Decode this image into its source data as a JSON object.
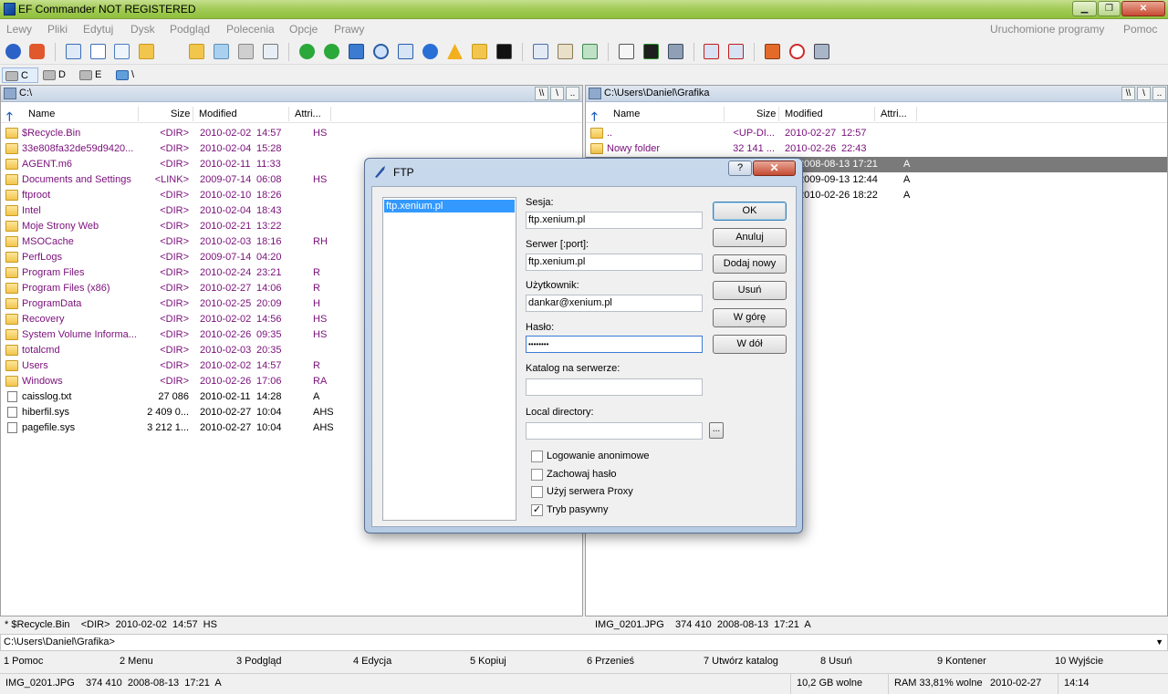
{
  "window": {
    "title": "EF Commander NOT REGISTERED",
    "min": "▁",
    "max": "❐",
    "close": "✕"
  },
  "menu": {
    "left": [
      "Lewy",
      "Pliki",
      "Edytuj",
      "Dysk",
      "Podgląd",
      "Polecenia",
      "Opcje",
      "Prawy"
    ],
    "right": [
      "Uruchomione programy",
      "Pomoc"
    ]
  },
  "drives": [
    {
      "letter": "C",
      "icon": "hard-drive-icon"
    },
    {
      "letter": "D",
      "icon": "optical-drive-icon"
    },
    {
      "letter": "E",
      "icon": "removable-drive-icon"
    },
    {
      "letter": "\\",
      "icon": "network-icon"
    }
  ],
  "left_panel": {
    "path": "C:\\",
    "headers": {
      "name": "Name",
      "size": "Size",
      "modified": "Modified",
      "attr": "Attri..."
    },
    "nav_buttons": [
      "\\\\",
      "\\",
      ".."
    ],
    "rows": [
      {
        "name": "$Recycle.Bin",
        "size": "<DIR>",
        "date": "2010-02-02",
        "time": "14:57",
        "attr": "HS",
        "type": "folder"
      },
      {
        "name": "33e808fa32de59d9420...",
        "size": "<DIR>",
        "date": "2010-02-04",
        "time": "15:28",
        "attr": "",
        "type": "folder"
      },
      {
        "name": "AGENT.m6",
        "size": "<DIR>",
        "date": "2010-02-11",
        "time": "11:33",
        "attr": "",
        "type": "folder"
      },
      {
        "name": "Documents and Settings",
        "size": "<LINK>",
        "date": "2009-07-14",
        "time": "06:08",
        "attr": "HS",
        "type": "link"
      },
      {
        "name": "ftproot",
        "size": "<DIR>",
        "date": "2010-02-10",
        "time": "18:26",
        "attr": "",
        "type": "folder"
      },
      {
        "name": "Intel",
        "size": "<DIR>",
        "date": "2010-02-04",
        "time": "18:43",
        "attr": "",
        "type": "folder"
      },
      {
        "name": "Moje Strony Web",
        "size": "<DIR>",
        "date": "2010-02-21",
        "time": "13:22",
        "attr": "",
        "type": "folder"
      },
      {
        "name": "MSOCache",
        "size": "<DIR>",
        "date": "2010-02-03",
        "time": "18:16",
        "attr": "RH",
        "type": "folder"
      },
      {
        "name": "PerfLogs",
        "size": "<DIR>",
        "date": "2009-07-14",
        "time": "04:20",
        "attr": "",
        "type": "folder"
      },
      {
        "name": "Program Files",
        "size": "<DIR>",
        "date": "2010-02-24",
        "time": "23:21",
        "attr": "R",
        "type": "folder"
      },
      {
        "name": "Program Files (x86)",
        "size": "<DIR>",
        "date": "2010-02-27",
        "time": "14:06",
        "attr": "R",
        "type": "folder"
      },
      {
        "name": "ProgramData",
        "size": "<DIR>",
        "date": "2010-02-25",
        "time": "20:09",
        "attr": "H",
        "type": "folder"
      },
      {
        "name": "Recovery",
        "size": "<DIR>",
        "date": "2010-02-02",
        "time": "14:56",
        "attr": "HS",
        "type": "folder"
      },
      {
        "name": "System Volume Informa...",
        "size": "<DIR>",
        "date": "2010-02-26",
        "time": "09:35",
        "attr": "HS",
        "type": "folder"
      },
      {
        "name": "totalcmd",
        "size": "<DIR>",
        "date": "2010-02-03",
        "time": "20:35",
        "attr": "",
        "type": "folder"
      },
      {
        "name": "Users",
        "size": "<DIR>",
        "date": "2010-02-02",
        "time": "14:57",
        "attr": "R",
        "type": "folder"
      },
      {
        "name": "Windows",
        "size": "<DIR>",
        "date": "2010-02-26",
        "time": "17:06",
        "attr": "RA",
        "type": "folder"
      },
      {
        "name": "caisslog.txt",
        "size": "27 086",
        "date": "2010-02-11",
        "time": "14:28",
        "attr": "A",
        "type": "file"
      },
      {
        "name": "hiberfil.sys",
        "size": "2 409 0...",
        "date": "2010-02-27",
        "time": "10:04",
        "attr": "AHS",
        "type": "file"
      },
      {
        "name": "pagefile.sys",
        "size": "3 212 1...",
        "date": "2010-02-27",
        "time": "10:04",
        "attr": "AHS",
        "type": "file"
      }
    ]
  },
  "right_panel": {
    "path": "C:\\Users\\Daniel\\Grafika",
    "headers": {
      "name": "Name",
      "size": "Size",
      "modified": "Modified",
      "attr": "Attri..."
    },
    "nav_buttons": [
      "\\\\",
      "\\",
      ".."
    ],
    "rows": [
      {
        "name": "..",
        "size": "<UP-DI...",
        "date": "2010-02-27",
        "time": "12:57",
        "attr": "",
        "type": "folder",
        "selected": false
      },
      {
        "name": "Nowy folder",
        "size": "32 141 ...",
        "date": "2010-02-26",
        "time": "22:43",
        "attr": "",
        "type": "folder",
        "selected": false
      },
      {
        "name": "",
        "size": "",
        "date": "",
        "time": "2008-08-13 17:21",
        "attr": "A",
        "type": "file",
        "selected": true
      },
      {
        "name": "",
        "size": "",
        "date": "",
        "time": "2009-09-13 12:44",
        "attr": "A",
        "type": "file",
        "selected": false
      },
      {
        "name": "",
        "size": "",
        "date": "",
        "time": "2010-02-26 18:22",
        "attr": "A",
        "type": "file",
        "selected": false
      }
    ]
  },
  "info": {
    "left": "* $Recycle.Bin    <DIR>  2010-02-02  14:57  HS",
    "right": "IMG_0201.JPG    374 410  2008-08-13  17:21  A"
  },
  "command_line": {
    "value": "C:\\Users\\Daniel\\Grafika>",
    "dropdown": "▼"
  },
  "fkeys": [
    "1 Pomoc",
    "2 Menu",
    "3 Podgląd",
    "4 Edycja",
    "5 Kopiuj",
    "6 Przenieś",
    "7 Utwórz katalog",
    "8 Usuń",
    "9 Kontener",
    "10 Wyjście"
  ],
  "status": {
    "file": "IMG_0201.JPG    374 410  2008-08-13  17:21  A",
    "free": "10,2 GB wolne",
    "ram": "RAM 33,81% wolne",
    "date": "2010-02-27",
    "time": "14:14"
  },
  "ftp_dialog": {
    "title": "FTP",
    "help_label": "?",
    "close_label": "✕",
    "sessions": [
      "ftp.xenium.pl"
    ],
    "fields": {
      "session_label": "Sesja:",
      "session_value": "ftp.xenium.pl",
      "server_label": "Serwer [:port]:",
      "server_value": "ftp.xenium.pl",
      "user_label": "Użytkownik:",
      "user_value": "dankar@xenium.pl",
      "password_label": "Hasło:",
      "password_value": "••••••••",
      "remote_dir_label": "Katalog na serwerze:",
      "remote_dir_value": "",
      "local_dir_label": "Local directory:",
      "local_dir_value": "",
      "browse_label": "..."
    },
    "buttons": [
      "OK",
      "Anuluj",
      "Dodaj nowy",
      "Usuń",
      "W górę",
      "W dół"
    ],
    "checkboxes": [
      {
        "label": "Logowanie anonimowe",
        "checked": false
      },
      {
        "label": "Zachowaj hasło",
        "checked": false
      },
      {
        "label": "Użyj serwera Proxy",
        "checked": false
      },
      {
        "label": "Tryb pasywny",
        "checked": true
      }
    ]
  }
}
